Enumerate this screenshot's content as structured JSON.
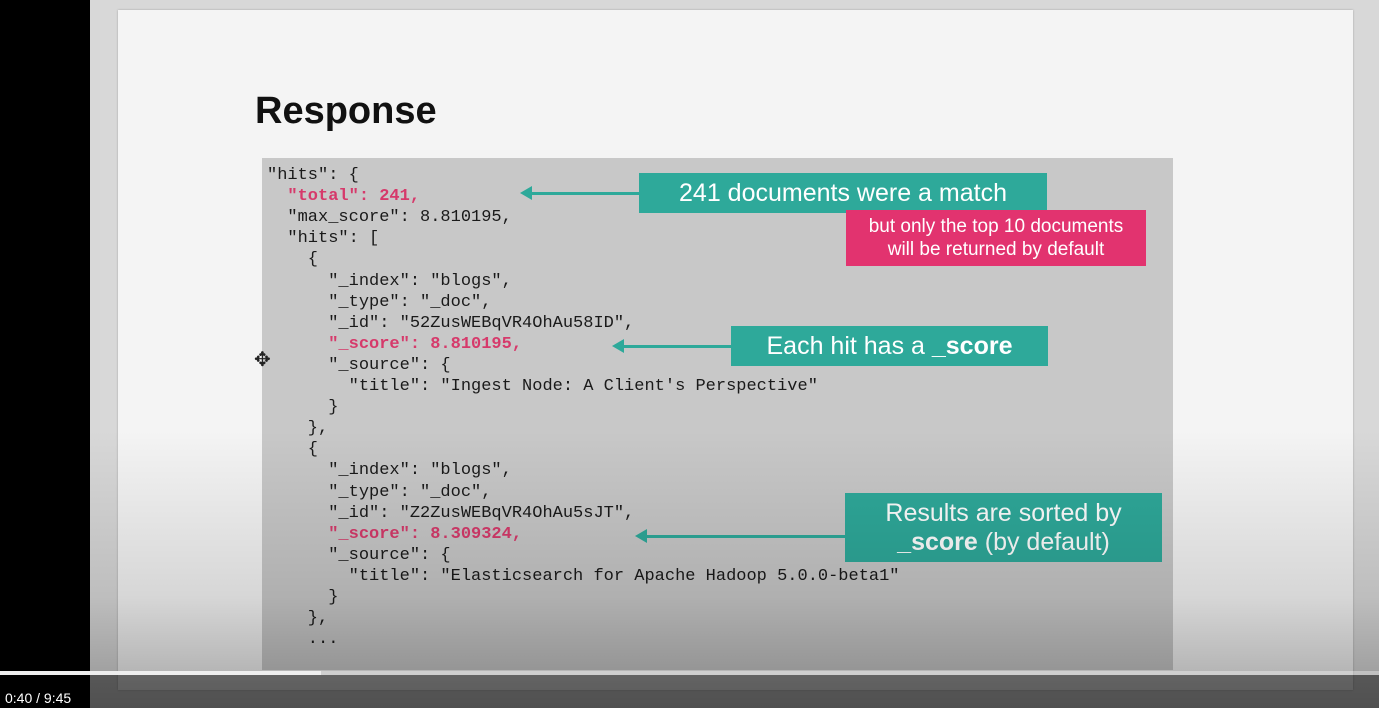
{
  "slide": {
    "title": "Response",
    "code_lines": [
      "\"hits\": {",
      "  \"total\": 241,",
      "  \"max_score\": 8.810195,",
      "  \"hits\": [",
      "    {",
      "      \"_index\": \"blogs\",",
      "      \"_type\": \"_doc\",",
      "      \"_id\": \"52ZusWEBqVR4OhAu58ID\",",
      "      \"_score\": 8.810195,",
      "      \"_source\": {",
      "        \"title\": \"Ingest Node: A Client's Perspective\"",
      "      }",
      "    },",
      "    {",
      "      \"_index\": \"blogs\",",
      "      \"_type\": \"_doc\",",
      "      \"_id\": \"Z2ZusWEBqVR4OhAu5sJT\",",
      "      \"_score\": 8.309324,",
      "      \"_source\": {",
      "        \"title\": \"Elasticsearch for Apache Hadoop 5.0.0-beta1\"",
      "      }",
      "    },",
      "    ..."
    ],
    "highlighted_lines": [
      1,
      8,
      17
    ],
    "callouts": {
      "match": "241 documents were a match",
      "top10_line1": "but only the top 10 documents",
      "top10_line2": "will be returned by default",
      "each_hit_prefix": "Each hit has a ",
      "each_hit_bold": "_score",
      "sorted_line1": "Results are sorted by",
      "sorted_bold": "_score",
      "sorted_suffix": " (by default)"
    },
    "colors": {
      "teal": "#2ea99a",
      "pink": "#e2336f",
      "highlight_text": "#d63a6b"
    }
  },
  "player": {
    "time": "0:40 / 9:45",
    "progress_fraction": 0.0684
  },
  "icons": {
    "cursor": "move-cursor-icon"
  }
}
